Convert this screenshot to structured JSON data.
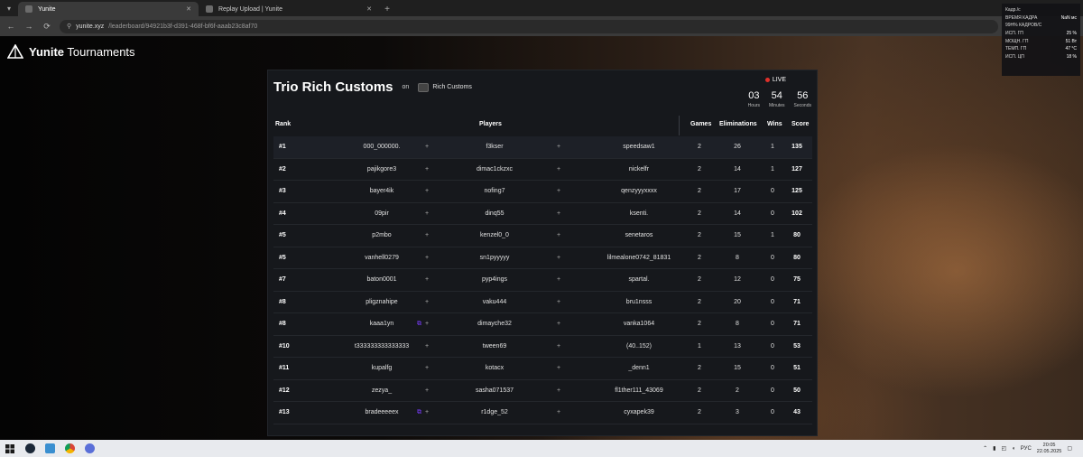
{
  "browser": {
    "tabs": [
      {
        "label": "Yunite",
        "active": true
      },
      {
        "label": "Replay Upload | Yunite",
        "active": false
      }
    ],
    "url_host": "yunite.xyz",
    "url_path": "/leaderboard/94921b3f-d391-468f-bf6f-aaab23c8af70"
  },
  "brand": {
    "bold": "Yunite",
    "rest": " Tournaments"
  },
  "leaderboard": {
    "title": "Trio Rich Customs",
    "on_label": "on",
    "org_name": "Rich Customs",
    "live_label": "LIVE",
    "timer": {
      "hours": "03",
      "hours_label": "Hours",
      "minutes": "54",
      "minutes_label": "Minutes",
      "seconds": "56",
      "seconds_label": "Seconds"
    },
    "headers": {
      "rank": "Rank",
      "players": "Players",
      "games": "Games",
      "eliminations": "Eliminations",
      "wins": "Wins",
      "score": "Score"
    },
    "rows": [
      {
        "rank": "#1",
        "p1": "000_000000.",
        "p2": "f3kser",
        "p3": "speedsaw1",
        "games": "2",
        "elims": "26",
        "wins": "1",
        "score": "135"
      },
      {
        "rank": "#2",
        "p1": "pajikgore3",
        "p2": "dimac1ckzxc",
        "p3": "nickelfr",
        "games": "2",
        "elims": "14",
        "wins": "1",
        "score": "127"
      },
      {
        "rank": "#3",
        "p1": "bayer4ik",
        "p2": "nofing7",
        "p3": "qenzyyyxxxx",
        "games": "2",
        "elims": "17",
        "wins": "0",
        "score": "125"
      },
      {
        "rank": "#4",
        "p1": "09pir",
        "p2": "dinq55",
        "p3": "ksenti.",
        "games": "2",
        "elims": "14",
        "wins": "0",
        "score": "102"
      },
      {
        "rank": "#5",
        "p1": "p2mbo",
        "p2": "kenzel0_0",
        "p3": "senetaros",
        "games": "2",
        "elims": "15",
        "wins": "1",
        "score": "80"
      },
      {
        "rank": "#5",
        "p1": "vanhell0279",
        "p2": "sn1pyyyyy",
        "p3": "lilmealone0742_81831",
        "games": "2",
        "elims": "8",
        "wins": "0",
        "score": "80"
      },
      {
        "rank": "#7",
        "p1": "baton0001",
        "p2": "pyp4ings",
        "p3": "spartal.",
        "games": "2",
        "elims": "12",
        "wins": "0",
        "score": "75"
      },
      {
        "rank": "#8",
        "p1": "pligznahipe",
        "p2": "vaku444",
        "p3": "bru1nsss",
        "games": "2",
        "elims": "20",
        "wins": "0",
        "score": "71"
      },
      {
        "rank": "#8",
        "p1": "kaaa1yn",
        "p2": "dimayche32",
        "p3": "vanka1064",
        "games": "2",
        "elims": "8",
        "wins": "0",
        "score": "71"
      },
      {
        "rank": "#10",
        "p1": "t333333333333333",
        "p2": "tween69",
        "p3": "(40..152)",
        "games": "1",
        "elims": "13",
        "wins": "0",
        "score": "53"
      },
      {
        "rank": "#11",
        "p1": "kupalfg",
        "p2": "kotacx",
        "p3": "_denn1",
        "games": "2",
        "elims": "15",
        "wins": "0",
        "score": "51"
      },
      {
        "rank": "#12",
        "p1": "zezya_",
        "p2": "sasha071537",
        "p3": "fl1ther111_43069",
        "games": "2",
        "elims": "2",
        "wins": "0",
        "score": "50"
      },
      {
        "rank": "#13",
        "p1": "bradeeeeex",
        "p2": "r1dge_52",
        "p3": "cyxapek39",
        "games": "2",
        "elims": "3",
        "wins": "0",
        "score": "43"
      }
    ],
    "plus": "+"
  },
  "overlay": [
    {
      "label": "Кадр./с",
      "value": ""
    },
    {
      "label": "ВРЕМЯ КАДРА",
      "value": "NaN мс"
    },
    {
      "label": "99Н% КАДРОВ/С",
      "value": ""
    },
    {
      "label": "ИСП. ГП",
      "value": "25 %"
    },
    {
      "label": "МОЩН. ГП",
      "value": "51 Вт"
    },
    {
      "label": "ТЕМП. ГП",
      "value": "47 °C"
    },
    {
      "label": "ИСП. ЦП",
      "value": "18 %"
    }
  ],
  "taskbar": {
    "lang": "РУС",
    "time": "20:05",
    "date": "22.05.2025"
  }
}
